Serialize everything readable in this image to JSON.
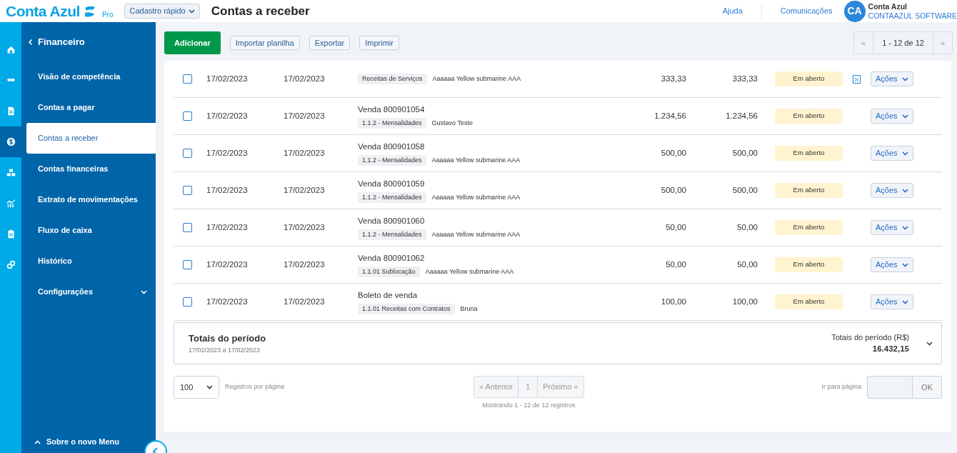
{
  "header": {
    "logo": "Conta Azul",
    "logo_tier": "Pro",
    "quick_add": "Cadastro rápido",
    "page_title": "Contas a receber",
    "links": [
      "Ajuda",
      "Comunicações"
    ],
    "avatar_initials": "CA",
    "user_name": "Conta Azul",
    "company": "CONTAAZUL SOFTWARE"
  },
  "sidebar": {
    "section": "Financeiro",
    "items": [
      {
        "label": "Visão de competência",
        "selected": false,
        "expandable": false
      },
      {
        "label": "Contas a pagar",
        "selected": false,
        "expandable": false
      },
      {
        "label": "Contas a receber",
        "selected": true,
        "expandable": false
      },
      {
        "label": "Contas financeiras",
        "selected": false,
        "expandable": false
      },
      {
        "label": "Extrato de movimentações",
        "selected": false,
        "expandable": false
      },
      {
        "label": "Fluxo de caixa",
        "selected": false,
        "expandable": false
      },
      {
        "label": "Histórico",
        "selected": false,
        "expandable": false
      },
      {
        "label": "Configurações",
        "selected": false,
        "expandable": true
      }
    ],
    "footer": "Sobre o novo Menu"
  },
  "toolbar": {
    "primary": "Adicionar",
    "buttons": [
      "Importar planilha",
      "Exportar",
      "Imprimir"
    ],
    "range": "1 - 12 de 12",
    "prev": "«",
    "next": "»"
  },
  "rows": [
    {
      "checked": false,
      "date_1": "17/02/2023",
      "date_2": "17/02/2023",
      "category": "Receitas de Serviços",
      "client": "Aaaaaa Yellow submarine AAA",
      "value_1": "333,33",
      "value_2": "333,33",
      "status": "Em aberto",
      "attachment": true,
      "action": "Ações"
    },
    {
      "checked": false,
      "date_1": "17/02/2023",
      "date_2": "17/02/2023",
      "title": "Venda 800901054",
      "category": "1.1.2 - Mensalidades",
      "client": "Gustavo Teste",
      "value_1": "1.234,56",
      "value_2": "1.234,56",
      "status": "Em aberto",
      "attachment": false,
      "action": "Ações"
    },
    {
      "checked": false,
      "date_1": "17/02/2023",
      "date_2": "17/02/2023",
      "title": "Venda 800901058",
      "category": "1.1.2 - Mensalidades",
      "client": "Aaaaaa Yellow submarine AAA",
      "value_1": "500,00",
      "value_2": "500,00",
      "status": "Em aberto",
      "attachment": false,
      "action": "Ações"
    },
    {
      "checked": false,
      "date_1": "17/02/2023",
      "date_2": "17/02/2023",
      "title": "Venda 800901059",
      "category": "1.1.2 - Mensalidades",
      "client": "Aaaaaa Yellow submarine AAA",
      "value_1": "500,00",
      "value_2": "500,00",
      "status": "Em aberto",
      "attachment": false,
      "action": "Ações"
    },
    {
      "checked": false,
      "date_1": "17/02/2023",
      "date_2": "17/02/2023",
      "title": "Venda 800901060",
      "category": "1.1.2 - Mensalidades",
      "client": "Aaaaaa Yellow submarine AAA",
      "value_1": "50,00",
      "value_2": "50,00",
      "status": "Em aberto",
      "attachment": false,
      "action": "Ações"
    },
    {
      "checked": false,
      "date_1": "17/02/2023",
      "date_2": "17/02/2023",
      "title": "Venda 800901062",
      "category": "1.1.01 Sublocação",
      "client": "Aaaaaa Yellow submarine AAA",
      "value_1": "50,00",
      "value_2": "50,00",
      "status": "Em aberto",
      "attachment": false,
      "action": "Ações"
    },
    {
      "checked": false,
      "date_1": "17/02/2023",
      "date_2": "17/02/2023",
      "title": "Boleto de venda",
      "category": "1.1.01 Receitas com Contratos",
      "client": "Bruna",
      "value_1": "100,00",
      "value_2": "100,00",
      "status": "Em aberto",
      "attachment": false,
      "action": "Ações"
    }
  ],
  "totals": {
    "title": "Totais do período",
    "range": "17/02/2023 a 17/02/2023",
    "label": "Totais do período (R$)",
    "value": "16.432,15"
  },
  "pagination": {
    "page_size": "100",
    "page_size_label": "Registros por página",
    "prev": "« Anterior",
    "page": "1",
    "next": "Próximo »",
    "summary": "Mostrando 1 - 12 de 12 registros",
    "goto_label": "Ir para página",
    "goto_button": "OK"
  }
}
